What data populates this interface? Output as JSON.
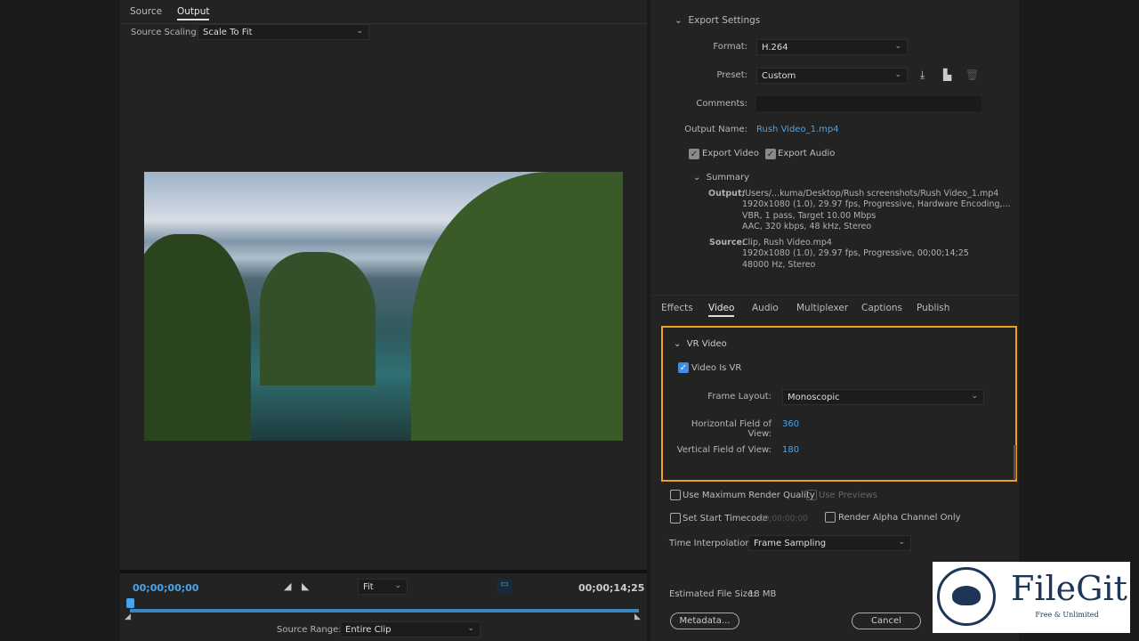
{
  "monitor": {
    "tabs": [
      "Source",
      "Output"
    ],
    "active_tab": "Output",
    "source_scaling_label": "Source Scaling:",
    "source_scaling": "Scale To Fit",
    "timecode_start": "00;00;00;00",
    "timecode_end": "00;00;14;25",
    "zoom": "Fit",
    "source_range_label": "Source Range:",
    "source_range": "Entire Clip",
    "playhead_fraction": 0.0
  },
  "export_settings": {
    "title": "Export Settings",
    "format_label": "Format:",
    "format": "H.264",
    "preset_label": "Preset:",
    "preset": "Custom",
    "comments_label": "Comments:",
    "comments": "",
    "output_name_label": "Output Name:",
    "output_name": "Rush Video_1.mp4",
    "export_video": "Export Video",
    "export_audio": "Export Audio",
    "summary": {
      "title": "Summary",
      "output_label": "Output:",
      "output_lines": [
        "/Users/...kuma/Desktop/Rush screenshots/Rush Video_1.mp4",
        "1920x1080 (1.0), 29.97 fps, Progressive, Hardware Encoding,...",
        "VBR, 1 pass, Target 10.00 Mbps",
        "AAC, 320 kbps, 48 kHz, Stereo"
      ],
      "source_label": "Source:",
      "source_lines": [
        "Clip, Rush Video.mp4",
        "1920x1080 (1.0), 29.97 fps, Progressive, 00;00;14;25",
        "48000 Hz, Stereo"
      ]
    }
  },
  "tabs": [
    "Effects",
    "Video",
    "Audio",
    "Multiplexer",
    "Captions",
    "Publish"
  ],
  "active_tab": "Video",
  "vr": {
    "title": "VR Video",
    "video_is_vr": "Video Is VR",
    "frame_layout_label": "Frame Layout:",
    "frame_layout": "Monoscopic",
    "hfov_label": "Horizontal Field of View:",
    "hfov": "360",
    "vfov_label": "Vertical Field of View:",
    "vfov": "180",
    "highlight_color": "#f0a020"
  },
  "options": {
    "max_render": "Use Maximum Render Quality",
    "use_previews": "Use Previews",
    "start_timecode": "Set Start Timecode",
    "start_timecode_value": "00;00;00;00",
    "alpha_only": "Render Alpha Channel Only",
    "time_interp_label": "Time Interpolation:",
    "time_interp": "Frame Sampling",
    "file_size_label": "Estimated File Size:",
    "file_size": "18 MB",
    "metadata": "Metadata...",
    "cancel": "Cancel"
  },
  "watermark": {
    "brand": "FileGit",
    "tagline": "Free & Unlimited"
  }
}
